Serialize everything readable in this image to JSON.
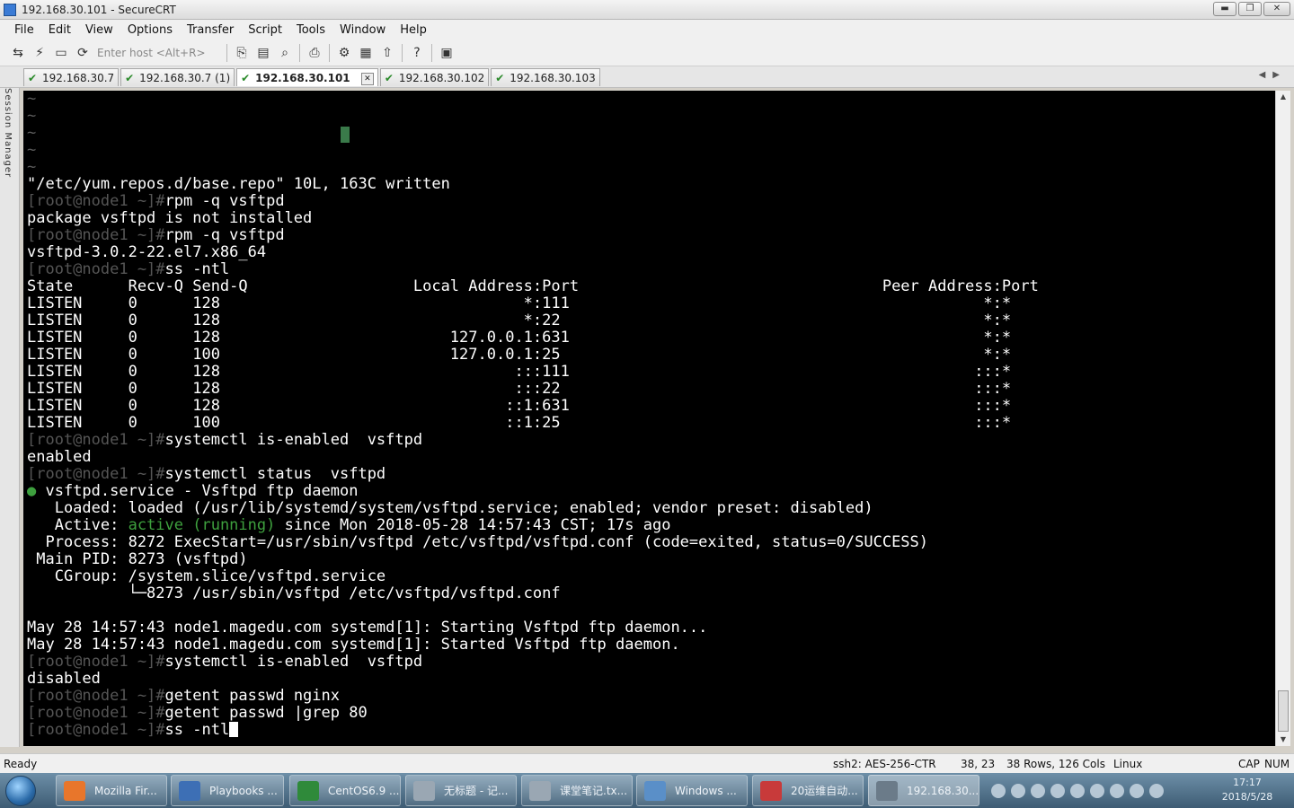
{
  "window": {
    "title": "192.168.30.101 - SecureCRT",
    "controls": {
      "minimize": "▬",
      "maximize": "❐",
      "close": "✕"
    }
  },
  "menu": [
    "File",
    "Edit",
    "View",
    "Options",
    "Transfer",
    "Script",
    "Tools",
    "Window",
    "Help"
  ],
  "toolbar": {
    "host_placeholder": "Enter host <Alt+R>",
    "icons": [
      "connect-icon",
      "quick-connect-icon",
      "connect-tab-icon",
      "reconnect-icon",
      "copy-icon",
      "paste-icon",
      "find-icon",
      "print-icon",
      "settings-icon",
      "keymap-icon",
      "sftp-icon",
      "help-icon",
      "session-icon"
    ]
  },
  "tabs": [
    {
      "label": "192.168.30.7",
      "active": false
    },
    {
      "label": "192.168.30.7 (1)",
      "active": false
    },
    {
      "label": "192.168.30.101",
      "active": true
    },
    {
      "label": "192.168.30.102",
      "active": false
    },
    {
      "label": "192.168.30.103",
      "active": false
    }
  ],
  "session_manager_label": "Session Manager",
  "terminal": {
    "tilde_lines": [
      "~",
      "~",
      "~",
      "~",
      "~"
    ],
    "lines": [
      {
        "t": "out",
        "text": "\"/etc/yum.repos.d/base.repo\" 10L, 163C written"
      },
      {
        "t": "cmd",
        "prompt": "[root@node1 ~]#",
        "text": "rpm -q vsftpd"
      },
      {
        "t": "out",
        "text": "package vsftpd is not installed"
      },
      {
        "t": "cmd",
        "prompt": "[root@node1 ~]#",
        "text": "rpm -q vsftpd"
      },
      {
        "t": "out",
        "text": "vsftpd-3.0.2-22.el7.x86_64"
      },
      {
        "t": "cmd",
        "prompt": "[root@node1 ~]#",
        "text": "ss -ntl"
      },
      {
        "t": "out",
        "text": "State      Recv-Q Send-Q                  Local Address:Port                                 Peer Address:Port"
      },
      {
        "t": "out",
        "text": "LISTEN     0      128                                 *:111                                             *:*"
      },
      {
        "t": "out",
        "text": "LISTEN     0      128                                 *:22                                              *:*"
      },
      {
        "t": "out",
        "text": "LISTEN     0      128                         127.0.0.1:631                                             *:*"
      },
      {
        "t": "out",
        "text": "LISTEN     0      100                         127.0.0.1:25                                              *:*"
      },
      {
        "t": "out",
        "text": "LISTEN     0      128                                :::111                                            :::*"
      },
      {
        "t": "out",
        "text": "LISTEN     0      128                                :::22                                             :::*"
      },
      {
        "t": "out",
        "text": "LISTEN     0      128                               ::1:631                                            :::*"
      },
      {
        "t": "out",
        "text": "LISTEN     0      100                               ::1:25                                             :::*"
      },
      {
        "t": "cmd",
        "prompt": "[root@node1 ~]#",
        "text": "systemctl is-enabled  vsftpd"
      },
      {
        "t": "out",
        "text": "enabled"
      },
      {
        "t": "cmd",
        "prompt": "[root@node1 ~]#",
        "text": "systemctl status  vsftpd"
      },
      {
        "t": "svc",
        "dot": "●",
        "text": " vsftpd.service - Vsftpd ftp daemon"
      },
      {
        "t": "out",
        "text": "   Loaded: loaded (/usr/lib/systemd/system/vsftpd.service; enabled; vendor preset: disabled)"
      },
      {
        "t": "active",
        "pre": "   Active: ",
        "status": "active (running)",
        "post": " since Mon 2018-05-28 14:57:43 CST; 17s ago"
      },
      {
        "t": "out",
        "text": "  Process: 8272 ExecStart=/usr/sbin/vsftpd /etc/vsftpd/vsftpd.conf (code=exited, status=0/SUCCESS)"
      },
      {
        "t": "out",
        "text": " Main PID: 8273 (vsftpd)"
      },
      {
        "t": "out",
        "text": "   CGroup: /system.slice/vsftpd.service"
      },
      {
        "t": "out",
        "text": "           └─8273 /usr/sbin/vsftpd /etc/vsftpd/vsftpd.conf"
      },
      {
        "t": "out",
        "text": ""
      },
      {
        "t": "out",
        "text": "May 28 14:57:43 node1.magedu.com systemd[1]: Starting Vsftpd ftp daemon..."
      },
      {
        "t": "out",
        "text": "May 28 14:57:43 node1.magedu.com systemd[1]: Started Vsftpd ftp daemon."
      },
      {
        "t": "cmd",
        "prompt": "[root@node1 ~]#",
        "text": "systemctl is-enabled  vsftpd"
      },
      {
        "t": "out",
        "text": "disabled"
      },
      {
        "t": "cmd",
        "prompt": "[root@node1 ~]#",
        "text": "getent passwd nginx"
      },
      {
        "t": "cmd",
        "prompt": "[root@node1 ~]#",
        "text": "getent passwd |grep 80"
      },
      {
        "t": "cur",
        "prompt": "[root@node1 ~]#",
        "text": "ss -ntl"
      }
    ]
  },
  "status": {
    "ready": "Ready",
    "cipher": "ssh2: AES-256-CTR",
    "cursor_pos": "38,  23",
    "size": "38 Rows, 126 Cols",
    "term": "Linux",
    "caps": "CAP",
    "num": "NUM"
  },
  "taskbar": {
    "items": [
      {
        "label": "Mozilla Fir...",
        "color": "#e8762b"
      },
      {
        "label": "Playbooks ...",
        "color": "#3d6fb5"
      },
      {
        "label": "CentOS6.9 ...",
        "color": "#2f8a3a"
      },
      {
        "label": "无标题 - 记...",
        "color": "#9aa7b3"
      },
      {
        "label": "课堂笔记.tx...",
        "color": "#9aa7b3"
      },
      {
        "label": "Windows ...",
        "color": "#5a8fc8"
      },
      {
        "label": "20运维自动...",
        "color": "#c83a3a"
      },
      {
        "label": "192.168.30...",
        "color": "#6b7b89"
      }
    ],
    "clock_time": "17:17",
    "clock_date": "2018/5/28"
  }
}
